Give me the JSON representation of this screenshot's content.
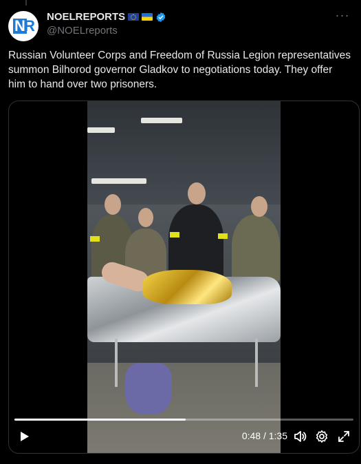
{
  "tweet": {
    "display_name": "NOELREPORTS",
    "handle": "@NOELreports",
    "avatar_text": "NR",
    "flags": [
      "eu-flag",
      "ukraine-flag"
    ],
    "verified": true,
    "text": "Russian Volunteer Corps and Freedom of Russia Legion representatives summon Bilhorod governor Gladkov to negotiations today. They offer him to hand over two prisoners.",
    "more_icon": "more-icon"
  },
  "video": {
    "current_time": "0:48",
    "duration": "1:35",
    "time_display": "0:48 / 1:35",
    "progress": 0.505,
    "controls": [
      "play-icon",
      "volume-icon",
      "settings-icon",
      "fullscreen-icon"
    ]
  },
  "colors": {
    "background": "#000000",
    "text": "#e7e9ea",
    "secondary_text": "#71767b",
    "verified": "#1d9bf0",
    "border": "#2f3336"
  }
}
